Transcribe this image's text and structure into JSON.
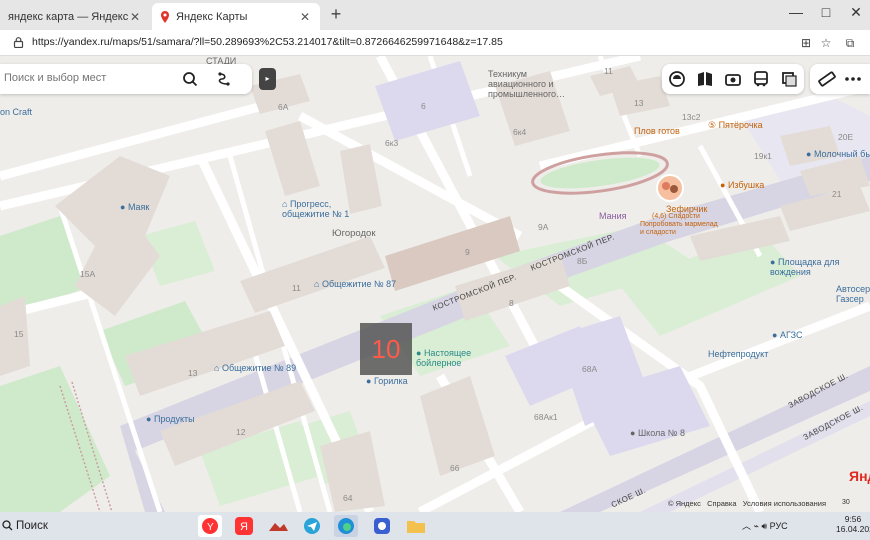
{
  "browser": {
    "tabs": [
      {
        "label": "яндекс карта — Яндекс: нашлось"
      },
      {
        "label": "Яндекс Карты"
      }
    ],
    "new_tab": "+",
    "window_controls": [
      "—",
      "□",
      "✕"
    ],
    "url": "https://yandex.ru/maps/51/samara/?ll=50.289693%2C53.214017&tilt=0.8726646259971648&z=17.85"
  },
  "map": {
    "search_placeholder": "Поиск и выбор мест",
    "collapse_label": "▸",
    "zoom_level": "10",
    "streets": {
      "kostromskoy_1": "КОСТРОМСКОЙ ПЕР.",
      "kostromskoy_2": "КОСТРОМСКОЙ ПЕР.",
      "zavodskoe_1": "ЗАВОДСКОЕ Ш.",
      "zavodskoe_2": "ЗАВОДСКОЕ Ш.",
      "zavodskoe_3": "СКОЕ Ш."
    },
    "pois": {
      "mayak": "Маяк",
      "progress": "Прогресс, общежитие № 1",
      "yugorodok": "Югородок",
      "obsh87": "Общежитие № 87",
      "obsh89": "Общежитие № 89",
      "produkty": "Продукты",
      "boiler": "Настоящее бойлерное",
      "gorilla": "Горилка",
      "technikum": "Техникум авиационного и промышленного…",
      "plov": "Плов готов",
      "pyaterochka": "Пятёрочка",
      "molochny": "Молочный бы",
      "izbushka": "Избушка",
      "zefirchik": "Зефирчик",
      "zefirchik_sub": "(4,6) Сладости",
      "zefirchik_sub2": "Попробовать мармелад и сладости",
      "maniya": "Мания",
      "ploshadka": "Площадка для вождения",
      "autoservice": "Автосерв Газсер",
      "agzs": "АГЗС",
      "neftprodukt": "Нефтепродукт",
      "school8": "Школа № 8",
      "craft": "on Craft",
      "stadium": "СТАДИ"
    },
    "numbers": {
      "n15a": "15А",
      "n15": "15",
      "n13": "13",
      "n12": "12",
      "n11": "11",
      "n9": "9",
      "n8": "8",
      "n6": "6",
      "n6a": "6А",
      "n6k3": "6к3",
      "n6k4": "6к4",
      "n9a": "9А",
      "n8b": "8Б",
      "n68a": "68А",
      "n68ak1": "68Ак1",
      "n66": "66",
      "n64": "64",
      "n13b": "13",
      "n11top": "11",
      "n13c2": "13с2",
      "n19k1": "19к1",
      "n20e": "20Е",
      "n21": "21",
      "n15b": "15"
    },
    "copyright": "© Яндекс",
    "help": "Справка",
    "terms": "Условия использования",
    "logo": "Янд",
    "scale": "30"
  },
  "taskbar": {
    "search_label": "Поиск",
    "lang": "РУС",
    "time": "9:56",
    "date": "16.04.202"
  },
  "colors": {
    "road": "#ffffff",
    "road_main": "#d7d5e3",
    "building": "#e3dcd6",
    "building_tall": "#d9c9c0",
    "green": "#cfeacb",
    "purple_bld": "#dcd9ee",
    "accent_red": "#ff5a4a"
  }
}
